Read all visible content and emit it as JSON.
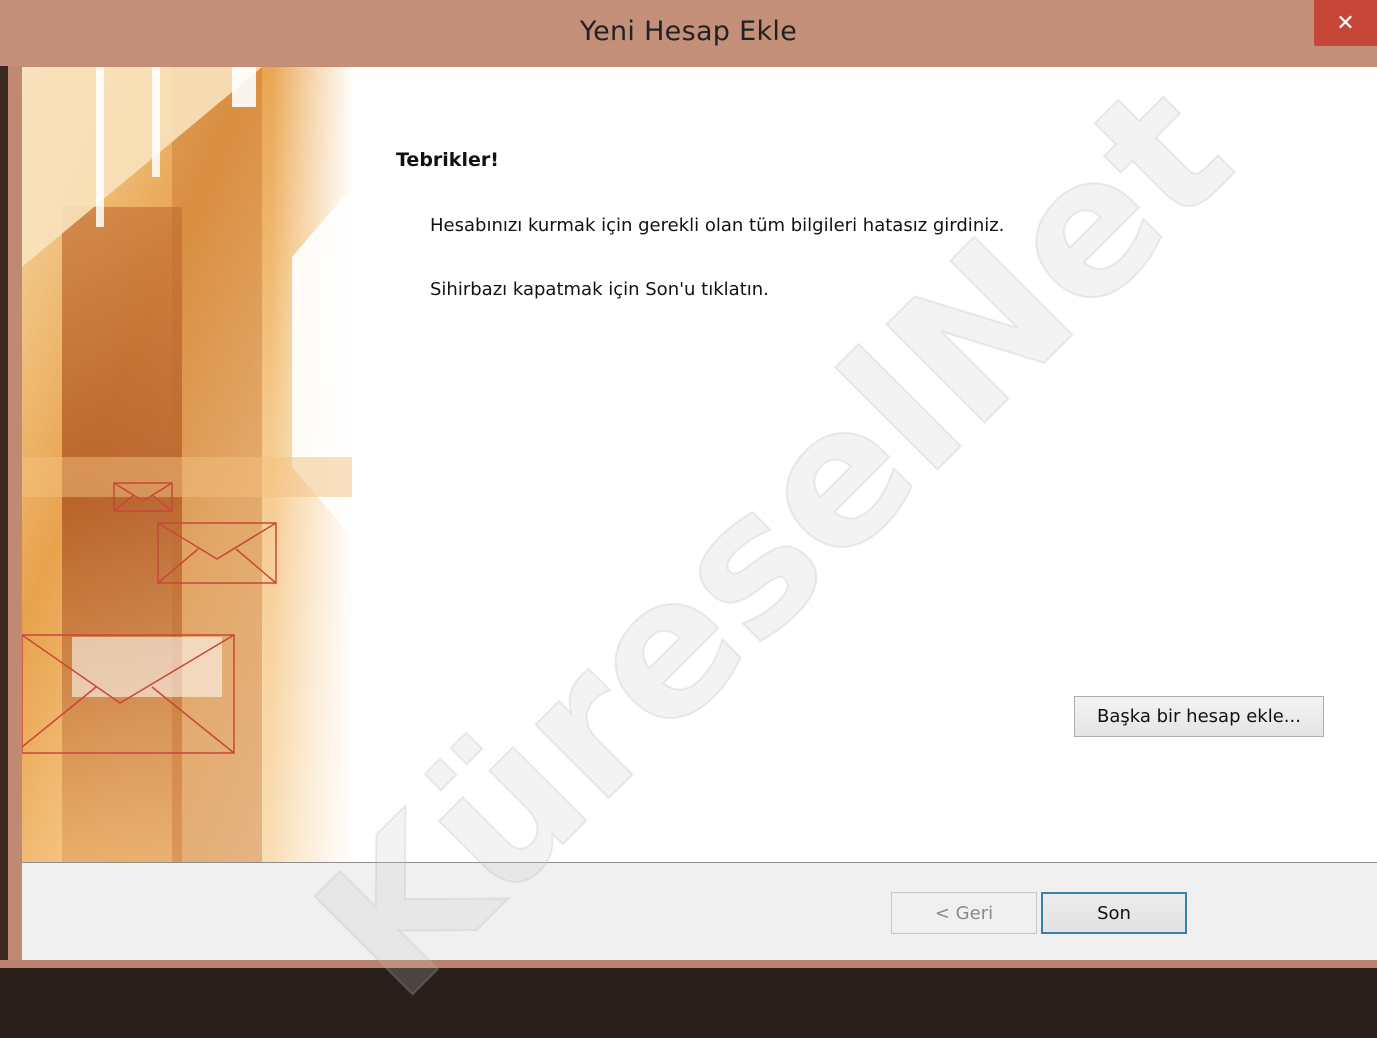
{
  "window": {
    "title": "Yeni Hesap Ekle",
    "close_glyph": "✕"
  },
  "content": {
    "heading": "Tebrikler!",
    "line1": "Hesabınızı kurmak için gerekli olan tüm bilgileri hatasız girdiniz.",
    "line2": "Sihirbazı kapatmak için Son'u tıklatın.",
    "add_account_label": "Başka bir hesap ekle..."
  },
  "footer": {
    "back_label": "< Geri",
    "finish_label": "Son"
  },
  "watermark": "KüreselNet",
  "colors": {
    "titlebar": "#c4907a",
    "close": "#c7463a",
    "accent": "#3c7fb1"
  },
  "icons": [
    "close-icon",
    "envelope-icon"
  ]
}
